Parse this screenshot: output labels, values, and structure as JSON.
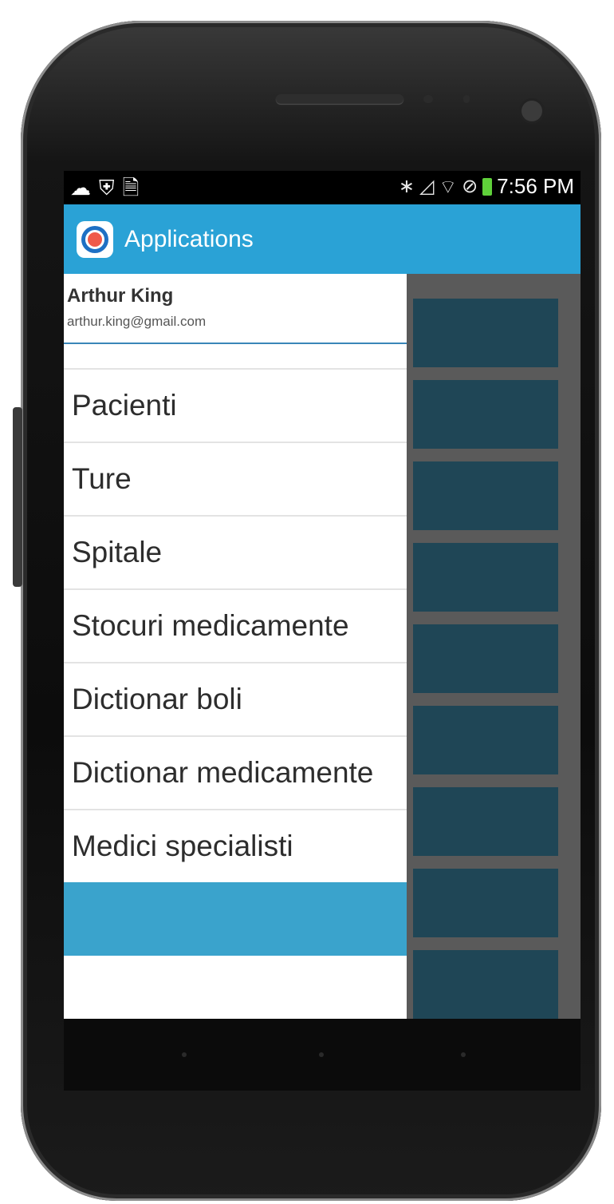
{
  "status_bar": {
    "left_icons": [
      "cloud-upload-icon",
      "shield-icon",
      "document-icon"
    ],
    "right_icons": [
      "bluetooth-icon",
      "no-signal-icon",
      "wifi-icon",
      "block-icon",
      "battery-icon"
    ],
    "time": "7:56 PM"
  },
  "app_bar": {
    "title": "Applications",
    "logo": "app-logo-icon"
  },
  "drawer": {
    "user_name": "Arthur King",
    "user_email": "arthur.king@gmail.com",
    "items": [
      {
        "label": "Pacienti"
      },
      {
        "label": "Ture"
      },
      {
        "label": "Spitale"
      },
      {
        "label": "Stocuri medicamente"
      },
      {
        "label": "Dictionar boli"
      },
      {
        "label": "Dictionar medicamente"
      },
      {
        "label": "Medici specialisti"
      }
    ]
  },
  "colors": {
    "app_bar": "#2aa2d6",
    "selected_item": "#3aa3cc",
    "content_tile": "#1f4656"
  }
}
